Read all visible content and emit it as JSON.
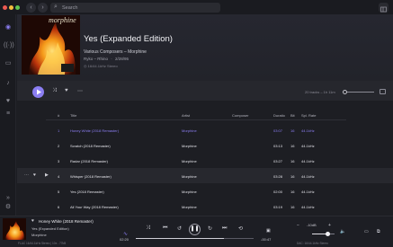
{
  "colors": {
    "accent": "#8b7ef2",
    "background": "#1c1d22",
    "traffic_close": "#ee5a52",
    "traffic_min": "#f5be3e",
    "traffic_max": "#5fc551"
  },
  "search": {
    "placeholder": "Search",
    "icon": "search-icon"
  },
  "album": {
    "title": "Yes (Expanded Edition)",
    "artists": "Various Composers – Morphine",
    "label": "Rykodisc",
    "label_year": "Ryko – Rhino",
    "date": "2/28/95",
    "quality": "16/44.1kHz Stereo"
  },
  "actions": {
    "summary": "20 tracks – 1h 11m"
  },
  "table": {
    "headers": {
      "number": "#",
      "title": "Title",
      "artist": "Artist",
      "composer": "Composer",
      "duration": "Duratio",
      "bit": "Bit",
      "rate": "Spl. Rate"
    },
    "rows": [
      {
        "number": "1",
        "title": "Honey White (2018 Remaster)",
        "artist": "Morphine",
        "composer": "",
        "duration": "03:07",
        "bit": "16",
        "rate": "44.1kHz",
        "playing": true
      },
      {
        "number": "2",
        "title": "Scratch (2018 Remaster)",
        "artist": "Morphine",
        "composer": "",
        "duration": "03:13",
        "bit": "16",
        "rate": "44.1kHz",
        "playing": false
      },
      {
        "number": "3",
        "title": "Radar (2018 Remaster)",
        "artist": "Morphine",
        "composer": "",
        "duration": "03:27",
        "bit": "16",
        "rate": "44.1kHz",
        "playing": false
      },
      {
        "number": "4",
        "title": "Whisper (2018 Remaster)",
        "artist": "Morphine",
        "composer": "",
        "duration": "03:28",
        "bit": "16",
        "rate": "44.1kHz",
        "playing": false,
        "hover": true
      },
      {
        "number": "5",
        "title": "Yes (2018 Remaster)",
        "artist": "Morphine",
        "composer": "",
        "duration": "02:00",
        "bit": "16",
        "rate": "44.1kHz",
        "playing": false
      },
      {
        "number": "6",
        "title": "All Your Way (2018 Remaster)",
        "artist": "Morphine",
        "composer": "",
        "duration": "03:19",
        "bit": "16",
        "rate": "44.1kHz",
        "playing": false
      }
    ]
  },
  "player": {
    "track": "Honey White (2018 Remaster)",
    "album": "Yes (Expanded Edition)",
    "artist": "Morphine",
    "format_left": "FLAC 16/44.1kHz Stereo | 10x - 77kB",
    "elapsed": "02:20",
    "remaining": "-00:47",
    "progress": 0.75,
    "volume_label": "-10dB",
    "volume": 0.7,
    "format_right": "DAC: 16/44.1kHz Stereo"
  }
}
